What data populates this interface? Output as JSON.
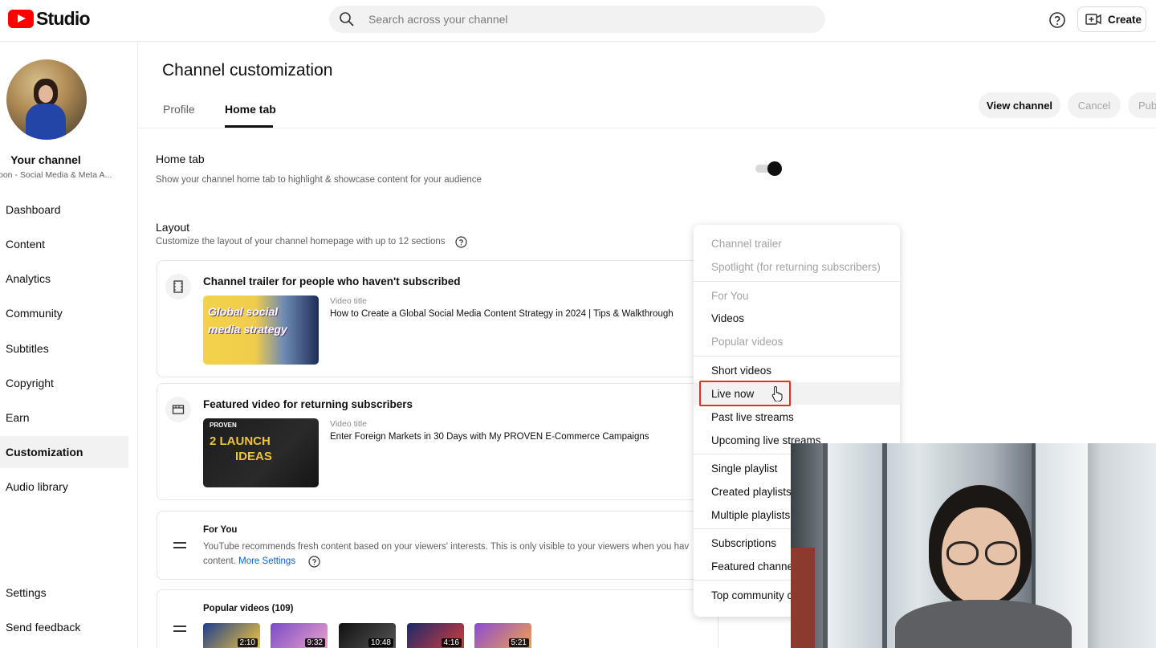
{
  "app": {
    "logo_text": "Studio",
    "brand_color": "#ff0000"
  },
  "search": {
    "placeholder": "Search across your channel"
  },
  "header": {
    "create_label": "Create"
  },
  "sidebar": {
    "channel_name": "Your channel",
    "channel_subtitle": "'oon - Social Media & Meta A...",
    "items": [
      {
        "label": "Dashboard",
        "active": false
      },
      {
        "label": "Content",
        "active": false
      },
      {
        "label": "Analytics",
        "active": false
      },
      {
        "label": "Community",
        "active": false
      },
      {
        "label": "Subtitles",
        "active": false
      },
      {
        "label": "Copyright",
        "active": false
      },
      {
        "label": "Earn",
        "active": false
      },
      {
        "label": "Customization",
        "active": true
      },
      {
        "label": "Audio library",
        "active": false
      }
    ],
    "bottom_items": [
      {
        "label": "Settings"
      },
      {
        "label": "Send feedback"
      }
    ]
  },
  "main": {
    "title": "Channel customization",
    "tabs": [
      {
        "label": "Profile",
        "active": false
      },
      {
        "label": "Home tab",
        "active": true
      }
    ],
    "actions": {
      "view_channel": "View channel",
      "cancel": "Cancel",
      "publish": "Pub"
    },
    "home_tab": {
      "title": "Home tab",
      "description": "Show your channel home tab to highlight & showcase content for your audience",
      "enabled": true
    },
    "layout": {
      "title": "Layout",
      "description": "Customize the layout of your channel homepage with up to 12 sections"
    },
    "sections": [
      {
        "title": "Channel trailer for people who haven't subscribed",
        "meta_label": "Video title",
        "video_title": "How to Create a Global Social Media Content Strategy in 2024 | Tips & Walkthrough",
        "thumb_line1": "Global social",
        "thumb_line2": "media strategy"
      },
      {
        "title": "Featured video for returning subscribers",
        "meta_label": "Video title",
        "video_title": "Enter Foreign Markets in 30 Days with My PROVEN E-Commerce Campaigns",
        "thumb_badge": "PROVEN",
        "thumb_line1": "2 LAUNCH",
        "thumb_line2": "IDEAS"
      },
      {
        "title": "For You",
        "description_line1": "YouTube recommends fresh content based on your viewers' interests. This is only visible to your viewers when you hav",
        "description_line2": "content.",
        "link": "More Settings"
      },
      {
        "title": "Popular videos (109)",
        "durations": [
          "2:10",
          "9:32",
          "10:48",
          "4:16",
          "5:21"
        ]
      }
    ]
  },
  "dropdown": {
    "groups": [
      [
        {
          "label": "Channel trailer",
          "disabled": true
        },
        {
          "label": "Spotlight (for returning subscribers)",
          "disabled": true
        }
      ],
      [
        {
          "label": "For You",
          "disabled": true
        },
        {
          "label": "Videos",
          "disabled": false
        },
        {
          "label": "Popular videos",
          "disabled": true
        }
      ],
      [
        {
          "label": "Short videos",
          "disabled": false
        },
        {
          "label": "Live now",
          "disabled": false,
          "highlighted": true
        },
        {
          "label": "Past live streams",
          "disabled": false
        },
        {
          "label": "Upcoming live streams",
          "disabled": false
        }
      ],
      [
        {
          "label": "Single playlist",
          "disabled": false
        },
        {
          "label": "Created playlists",
          "disabled": false
        },
        {
          "label": "Multiple playlists",
          "disabled": false
        }
      ],
      [
        {
          "label": "Subscriptions",
          "disabled": false
        },
        {
          "label": "Featured channe",
          "disabled": false
        }
      ],
      [
        {
          "label": "Top community c",
          "disabled": false
        }
      ]
    ]
  }
}
